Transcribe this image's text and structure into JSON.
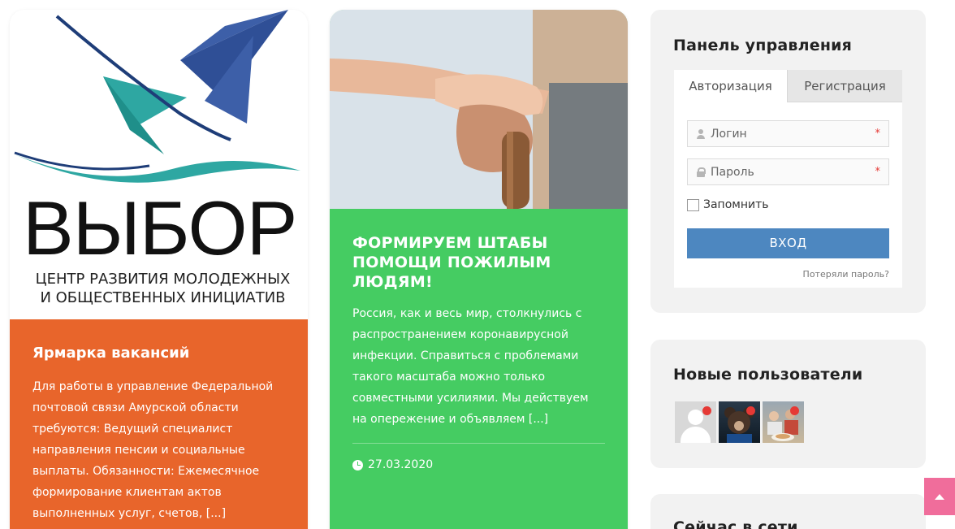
{
  "cards": [
    {
      "logo": {
        "big_text": "ВЫБОР",
        "subtitle_line1": "ЦЕНТР РАЗВИТИЯ МОЛОДЕЖНЫХ",
        "subtitle_line2": "И ОБЩЕСТВЕННЫХ ИНИЦИАТИВ"
      },
      "title": "Ярмарка вакансий",
      "text": "Для работы в управление Федеральной почтовой связи Амурской области требуются: Ведущий специалист направления пенсии и социальные выплаты. Обязанности: Ежемесячное формирование клиентам актов выполненных услуг, счетов, [...]",
      "color": "#e8652b"
    },
    {
      "title": "Формируем штабы помощи пожилым людям!",
      "text": "Россия, как и весь мир, столкнулись с распространением коронавирусной инфекции. Справиться с проблемами такого масштаба можно только совместными усилиями. Мы действуем на опережение и объявляем [...]",
      "date": "27.03.2020",
      "color": "#45cc62"
    }
  ],
  "sidebar": {
    "control_panel": {
      "title": "Панель управления",
      "tabs": [
        "Авторизация",
        "Регистрация"
      ],
      "login_placeholder": "Логин",
      "password_placeholder": "Пароль",
      "required_mark": "*",
      "remember_label": "Запомнить",
      "login_button": "ВХОД",
      "lost_password": "Потеряли пароль?"
    },
    "new_users": {
      "title": "Новые пользователи"
    },
    "online": {
      "title": "Сейчас в сети"
    }
  },
  "colors": {
    "accent_orange": "#e8652b",
    "accent_green": "#45cc62",
    "button_blue": "#4d87c0",
    "scroll_top_pink": "#f06d9b"
  }
}
